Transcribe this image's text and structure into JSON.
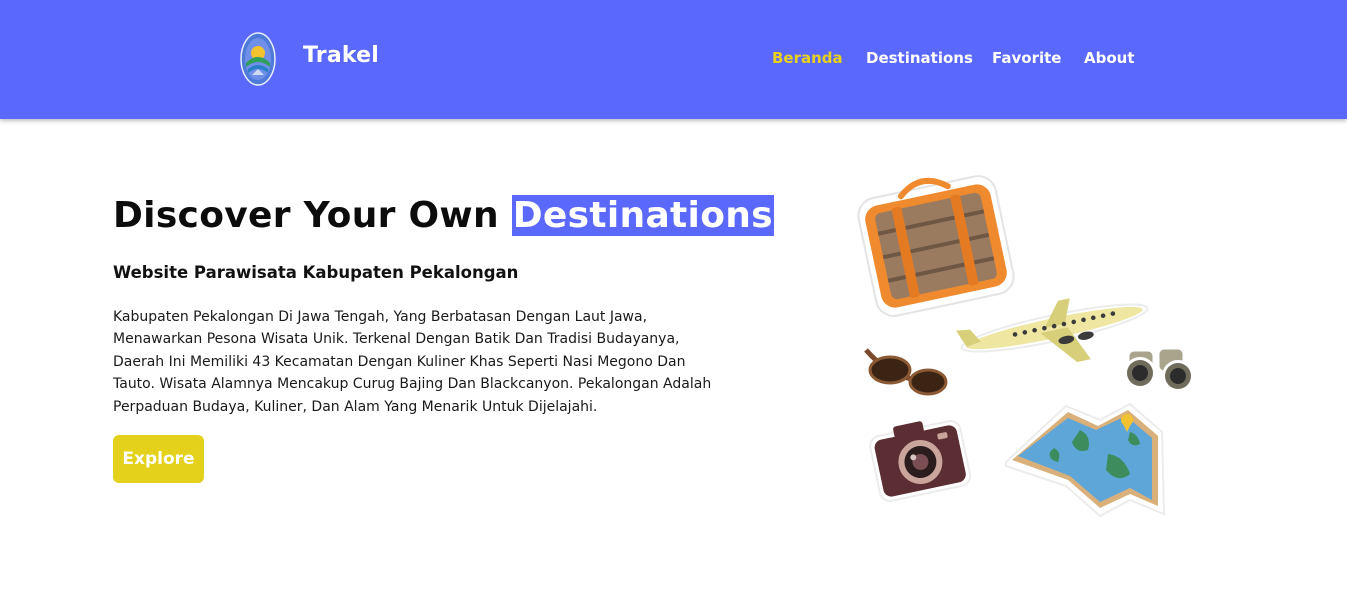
{
  "brand": {
    "name": "Trakel",
    "logo_icon": "pekalongan-emblem-icon"
  },
  "nav": {
    "items": [
      {
        "label": "Beranda",
        "active": true
      },
      {
        "label": "Destinations",
        "active": false
      },
      {
        "label": "Favorite",
        "active": false
      },
      {
        "label": "About",
        "active": false
      }
    ]
  },
  "hero": {
    "title_prefix": "Discover Your Own",
    "title_highlight": "Destinations",
    "subtitle": "Website Parawisata Kabupaten Pekalongan",
    "description": "Kabupaten Pekalongan Di Jawa Tengah, Yang Berbatasan Dengan Laut Jawa, Menawarkan Pesona Wisata Unik. Terkenal Dengan Batik Dan Tradisi Budayanya, Daerah Ini Memiliki 43 Kecamatan Dengan Kuliner Khas Seperti Nasi Megono Dan Tauto. Wisata Alamnya Mencakup Curug Bajing Dan Blackcanyon. Pekalongan Adalah Perpaduan Budaya, Kuliner, Dan Alam Yang Menarik Untuk Dijelajahi.",
    "cta_label": "Explore"
  },
  "illustration": {
    "icons": [
      "suitcase-icon",
      "airplane-icon",
      "sunglasses-icon",
      "binoculars-icon",
      "camera-icon",
      "map-icon"
    ]
  },
  "colors": {
    "primary": "#5a68fb",
    "accent": "#e3d11c",
    "text": "#0c0c0c",
    "background": "#ffffff"
  }
}
